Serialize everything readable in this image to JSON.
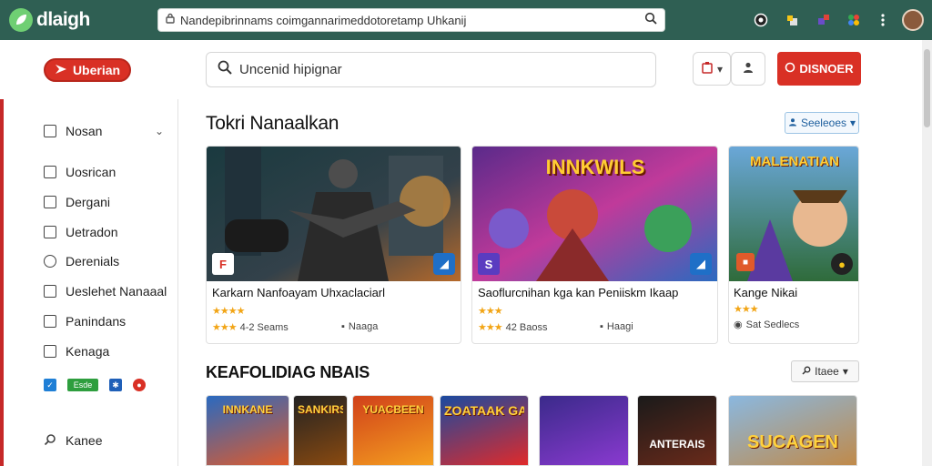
{
  "browser": {
    "logo_text": "dlaigh",
    "url": "Nandepibrinnams coimgannarimeddotoretamp Uhkanij",
    "icons": [
      "refresh-icon",
      "extension-icon",
      "puzzle-icon",
      "colorwheel-icon",
      "menu-icon"
    ]
  },
  "header": {
    "brand_label": "Uberian",
    "search_value": "Uncenid hipignar",
    "cta_label": "DISNOER",
    "accent": "#d93025"
  },
  "sidebar": {
    "items": [
      {
        "label": "Nosan",
        "icon": "inbox-icon"
      },
      {
        "label": "Uosrican",
        "icon": "folder-icon"
      },
      {
        "label": "Dergani",
        "icon": "calendar-icon"
      },
      {
        "label": "Uetradon",
        "icon": "square-icon"
      },
      {
        "label": "Derenials",
        "icon": "settings-icon"
      },
      {
        "label": "Ueslehet Nanaaal",
        "icon": "grid-icon"
      },
      {
        "label": "Panindans",
        "icon": "book-icon"
      },
      {
        "label": "Kenaga",
        "icon": "news-icon"
      },
      {
        "label": "Kanee",
        "icon": "search-icon"
      }
    ],
    "mini_label": "Esde"
  },
  "sections": {
    "featured": {
      "title": "Tokri Nanaalkan",
      "filter_label": "Seeleoes"
    },
    "recent": {
      "title": "KEAFOLIDIAG NBAIS",
      "filter_label": "Itaee"
    }
  },
  "cards": [
    {
      "title": "Karkarn Nanfoayam Uhxaclaciarl",
      "meta_left": "4-2 Seams",
      "meta_right": "Naaga"
    },
    {
      "title": "Saoflurcnihan kga kan Peniiskm Ikaap",
      "meta_left": "42 Baoss",
      "meta_right": "Haagi",
      "image_title": "INNKWILS"
    },
    {
      "title": "Kange Nikai",
      "meta_left": "Sat Sedlecs",
      "image_title": "MALENATIAN"
    }
  ],
  "tiles": [
    {
      "label": "INNKANE"
    },
    {
      "label": "SANKIRS"
    },
    {
      "label": "YUACBEEN"
    },
    {
      "label": "ZOATAAK GAME"
    },
    {
      "label": ""
    },
    {
      "label": "ANTERAIS"
    },
    {
      "label": "SUCAGEN"
    }
  ]
}
